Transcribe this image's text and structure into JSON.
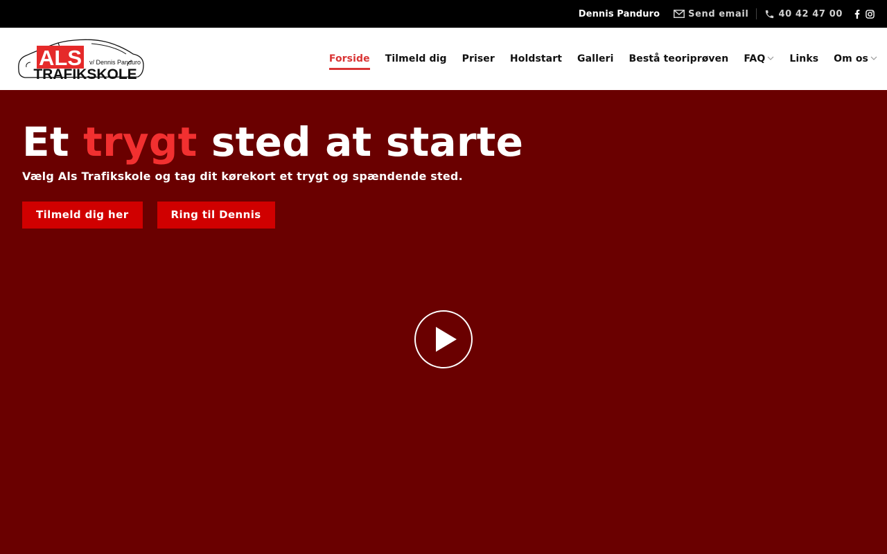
{
  "topbar": {
    "name": "Dennis Panduro",
    "email_label": "Send email",
    "phone": "40 42 47 00",
    "icons": [
      "envelope-icon",
      "phone-icon",
      "facebook-icon",
      "instagram-icon"
    ]
  },
  "logo": {
    "brand": "ALS",
    "subtitle": "v/ Dennis Panduro",
    "name": "TRAFIKSKOLE"
  },
  "nav": {
    "items": [
      {
        "label": "Forside",
        "active": true
      },
      {
        "label": "Tilmeld dig"
      },
      {
        "label": "Priser"
      },
      {
        "label": "Holdstart"
      },
      {
        "label": "Galleri"
      },
      {
        "label": "Bestå teoriprøven"
      },
      {
        "label": "FAQ",
        "dropdown": true
      },
      {
        "label": "Links"
      },
      {
        "label": "Om os",
        "dropdown": true
      }
    ]
  },
  "hero": {
    "title_pre": "Et ",
    "title_accent": "trygt",
    "title_post": " sted at starte",
    "subtitle": "Vælg Als Trafikskole og tag dit kørekort et trygt og spændende sted.",
    "btn_primary": "Tilmeld dig her",
    "btn_secondary": "Ring til Dennis"
  },
  "colors": {
    "accent": "#d93434",
    "hero_bg": "#6a0000",
    "button": "#d00000",
    "topbar_bg": "#000000"
  }
}
